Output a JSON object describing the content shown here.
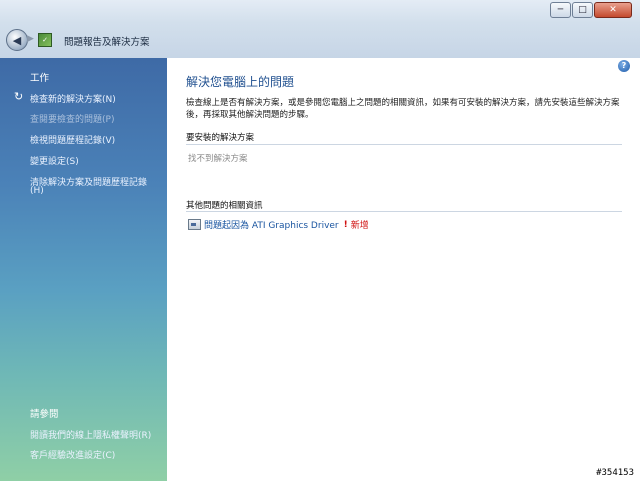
{
  "window": {
    "title": "問題報告及解決方案",
    "min_label": "─",
    "max_label": "□",
    "close_label": "✕",
    "back_glyph": "◀",
    "fwd_glyph": "▶"
  },
  "sidebar": {
    "tasks_header": "工作",
    "task_links": [
      {
        "label": "檢查新的解決方案(N)",
        "enabled": true,
        "icon": "shield-refresh-icon"
      },
      {
        "label": "查閱要檢查的問題(P)",
        "enabled": false
      },
      {
        "label": "檢視問題歷程記錄(V)",
        "enabled": true
      },
      {
        "label": "變更設定(S)",
        "enabled": true
      },
      {
        "label": "清除解決方案及問題歷程記錄",
        "enabled": true
      },
      {
        "label": "(H)",
        "enabled": true
      }
    ],
    "see_also_header": "請參閱",
    "see_also_links": [
      {
        "label": "閱讀我們的線上隱私權聲明(R)"
      },
      {
        "label": "客戶經驗改進設定(C)"
      }
    ]
  },
  "main": {
    "help_glyph": "?",
    "title": "解決您電腦上的問題",
    "description": "檢查線上是否有解決方案，或是參閱您電腦上之問題的相關資訊，如果有可安裝的解決方案，請先安裝這些解決方案後，再採取其他解決問題的步驟。",
    "install_section": {
      "header": "要安裝的解決方案",
      "empty_text": "找不到解決方案"
    },
    "info_section": {
      "header": "其他問題的相關資訊",
      "items": [
        {
          "link": "問題起因為 ATI Graphics Driver",
          "bang": "!",
          "badge": "新增",
          "icon": "problem-report-icon"
        }
      ]
    }
  },
  "watermark": "#354153",
  "colors": {
    "link": "#1a55a0",
    "badge": "#d01010",
    "title": "#1f4f8f"
  }
}
